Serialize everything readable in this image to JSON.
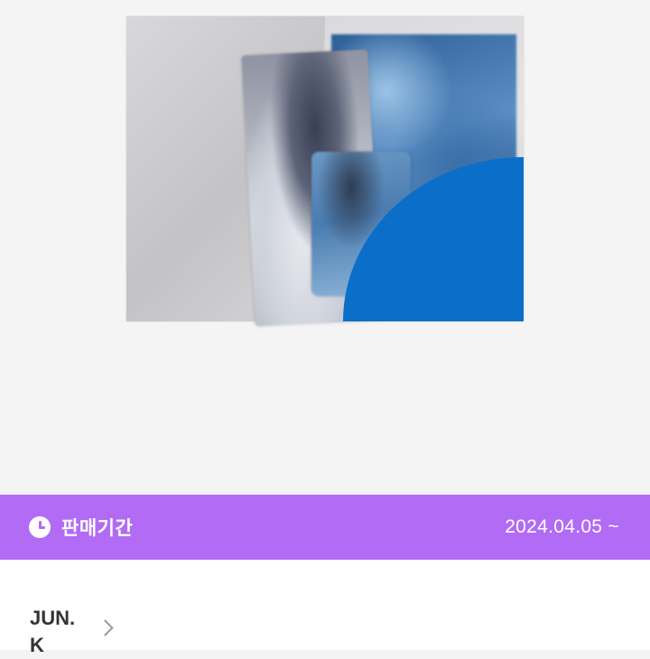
{
  "product": {
    "image_alt": "album product image"
  },
  "sale_period": {
    "icon": "clock-icon",
    "label": "판매기간",
    "value": "2024.04.05 ~",
    "bar_color": "#b26bf4"
  },
  "artist": {
    "name": "JUN. K",
    "chevron_icon": "chevron-right-icon"
  },
  "colors": {
    "accent": "#b26bf4",
    "product_blue": "#0b6fc9"
  }
}
